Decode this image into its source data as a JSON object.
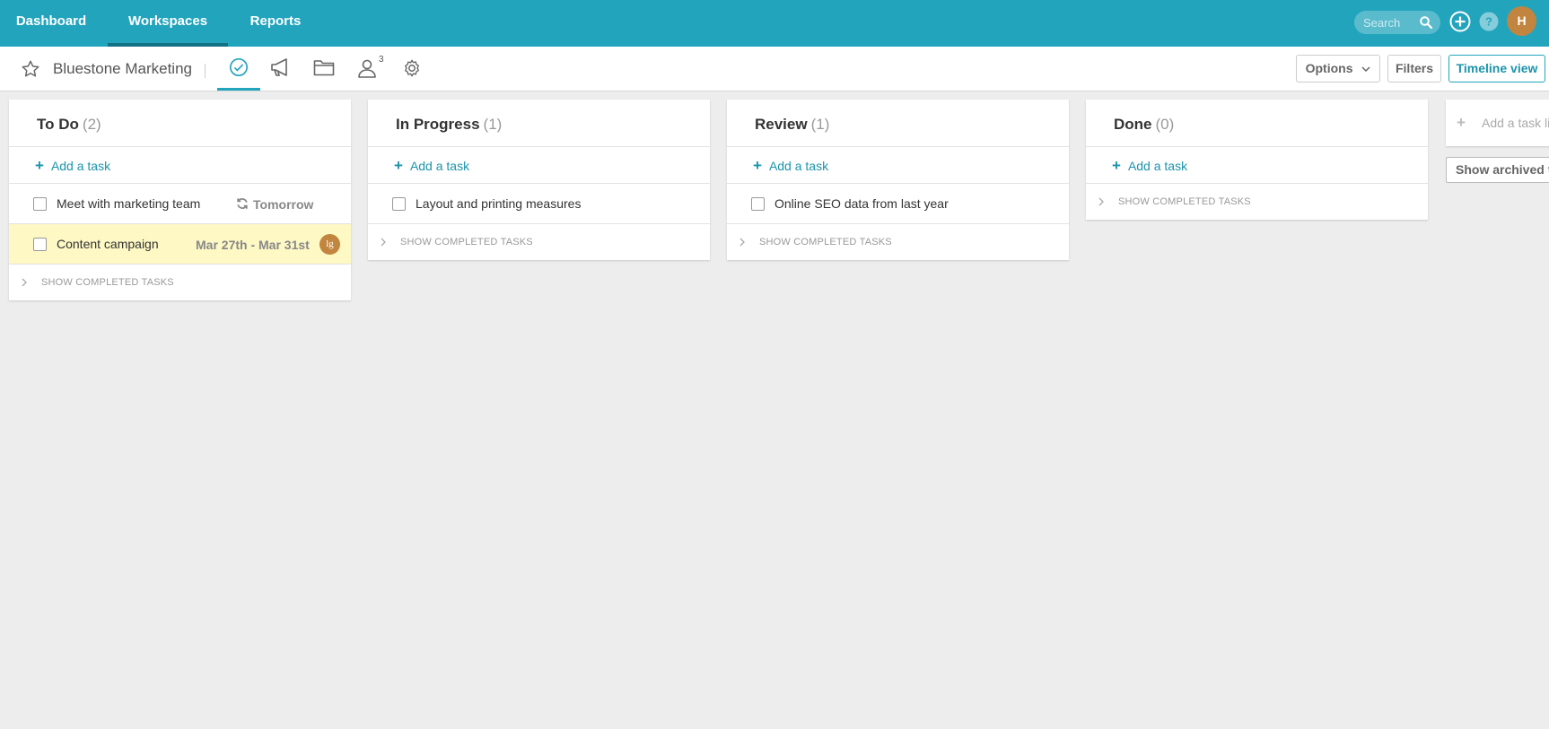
{
  "nav": {
    "items": [
      {
        "label": "Dashboard",
        "active": false
      },
      {
        "label": "Workspaces",
        "active": true
      },
      {
        "label": "Reports",
        "active": false
      }
    ],
    "search_placeholder": "Search",
    "user_initial": "H"
  },
  "workspace": {
    "title": "Bluestone Marketing",
    "members_count": "3",
    "options_label": "Options",
    "filters_label": "Filters",
    "timeline_label": "Timeline view"
  },
  "columns": [
    {
      "title": "To Do",
      "count": "(2)",
      "add_label": "Add a task",
      "tasks": [
        {
          "text": "Meet with marketing team",
          "meta": "Tomorrow",
          "recurring": true
        },
        {
          "text": "Content campaign",
          "meta": "Mar 27th - Mar 31st",
          "assignee": "lg",
          "highlight": true
        }
      ],
      "show_completed": "SHOW COMPLETED TASKS"
    },
    {
      "title": "In Progress",
      "count": "(1)",
      "add_label": "Add a task",
      "tasks": [
        {
          "text": "Layout and printing measures"
        }
      ],
      "show_completed": "SHOW COMPLETED TASKS"
    },
    {
      "title": "Review",
      "count": "(1)",
      "add_label": "Add a task",
      "tasks": [
        {
          "text": "Online SEO data from last year"
        }
      ],
      "show_completed": "SHOW COMPLETED TASKS"
    },
    {
      "title": "Done",
      "count": "(0)",
      "add_label": "Add a task",
      "tasks": [],
      "show_completed": "SHOW COMPLETED TASKS"
    }
  ],
  "add_task_list_label": "Add a task list",
  "show_archived_label": "Show archived task lists",
  "colors": {
    "accent": "#23a4bd",
    "link": "#1b94ac",
    "highlight_row": "#fdf8c4",
    "avatar": "#c2853f"
  }
}
